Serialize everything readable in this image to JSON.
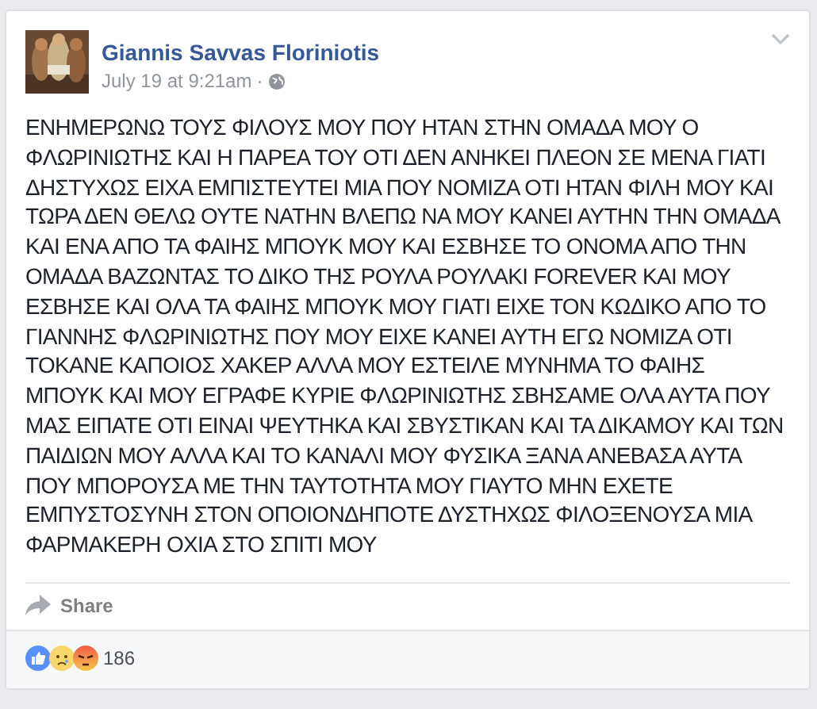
{
  "post": {
    "author": "Giannis Savvas Floriniotis",
    "time": "July 19 at 9:21am",
    "separator": "·",
    "body_lines": [
      "ΕΝΗΜΕΡΩΝΩ ΤΟΥΣ ΦΙΛΟΥΣ ΜΟΥ ΠΟΥ ΗΤΑΝ ΣΤΗΝ ΟΜΑΔΑ ΜΟΥ Ο",
      "ΦΛΩΡΙΝΙΩΤΗΣ ΚΑΙ Η ΠΑΡΕΑ ΤΟΥ ΟΤΙ ΔΕΝ ΑΝΗΚΕΙ ΠΛΕΟΝ ΣΕ ΜΕΝΑ ΓΙΑΤΙ",
      "ΔΗΣΤΥΧΩΣ ΕΙΧΑ ΕΜΠΙΣΤΕΥΤΕΙ ΜΙΑ ΠΟΥ ΝΟΜΙΖΑ ΟΤΙ ΗΤΑΝ ΦΙΛΗ ΜΟΥ ΚΑΙ",
      "ΤΩΡΑ ΔΕΝ ΘΕΛΩ ΟΥΤΕ ΝΑΤΗΝ ΒΛΕΠΩ ΝΑ ΜΟΥ ΚΑΝΕΙ ΑΥΤΗΝ ΤΗΝ ΟΜΑΔΑ",
      "ΚΑΙ ΕΝΑ ΑΠΟ ΤΑ ΦΑΙΗΣ ΜΠΟΥΚ ΜΟΥ ΚΑΙ ΕΣΒΗΣΕ ΤΟ ΟΝΟΜΑ ΑΠΟ ΤΗΝ",
      "ΟΜΑΔΑ ΒΑΖΩΝΤΑΣ ΤΟ ΔΙΚΟ ΤΗΣ ΡΟΥΛΑ ΡΟΥΛΑΚΙ FOREVER ΚΑΙ ΜΟΥ",
      "ΕΣΒΗΣΕ ΚΑΙ ΟΛΑ ΤΑ ΦΑΙΗΣ ΜΠΟΥΚ ΜΟΥ ΓΙΑΤΙ ΕΙΧΕ ΤΟΝ ΚΩΔΙΚΟ ΑΠΟ ΤΟ",
      "ΓΙΑΝΝΗΣ ΦΛΩΡΙΝΙΩΤΗΣ ΠΟΥ ΜΟΥ ΕΙΧΕ ΚΑΝΕΙ ΑΥΤΗ ΕΓΩ ΝΟΜΙΖΑ ΟΤΙ",
      "ΤΟΚΑΝΕ ΚΑΠΟΙΟΣ ΧΑΚΕΡ ΑΛΛΑ ΜΟΥ ΕΣΤΕΙΛΕ ΜΥΝΗΜΑ ΤΟ ΦΑΙΗΣ",
      "ΜΠΟΥΚ ΚΑΙ ΜΟΥ ΕΓΡΑΦΕ ΚΥΡΙΕ ΦΛΩΡΙΝΙΩΤΗΣ ΣΒΗΣΑΜΕ ΟΛΑ ΑΥΤΑ ΠΟΥ",
      "ΜΑΣ ΕΙΠΑΤΕ ΟΤΙ ΕΙΝΑΙ ΨΕΥΤΗΚΑ ΚΑΙ ΣΒΥΣΤΙΚΑΝ ΚΑΙ ΤΑ ΔΙΚΑΜΟΥ ΚΑΙ ΤΩΝ",
      "ΠΑΙΔΙΩΝ ΜΟΥ ΑΛΛΑ ΚΑΙ ΤΟ ΚΑΝΑΛΙ ΜΟΥ ΦΥΣΙΚΑ ΞΑΝΑ ΑΝΕΒΑΣΑ ΑΥΤΑ",
      "ΠΟΥ ΜΠΟΡΟΥΣΑ ΜΕ ΤΗΝ ΤΑΥΤΟΤΗΤΑ ΜΟΥ ΓΙΑΥΤΟ ΜΗΝ ΕΧΕΤΕ",
      "ΕΜΠΥΣΤΟΣΥΝΗ ΣΤΟΝ ΟΠΟΙΟΝΔΗΠΟΤΕ ΔΥΣΤΗΧΩΣ ΦΙΛΟΞΕΝΟΥΣΑ ΜΙΑ",
      "ΦΑΡΜΑΚΕΡΗ ΟΧΙΑ ΣΤΟ ΣΠΙΤΙ ΜΟΥ"
    ],
    "share_label": "Share",
    "reactions": [
      {
        "kind": "like"
      },
      {
        "kind": "sad"
      },
      {
        "kind": "angry"
      }
    ],
    "reaction_count": "186"
  }
}
